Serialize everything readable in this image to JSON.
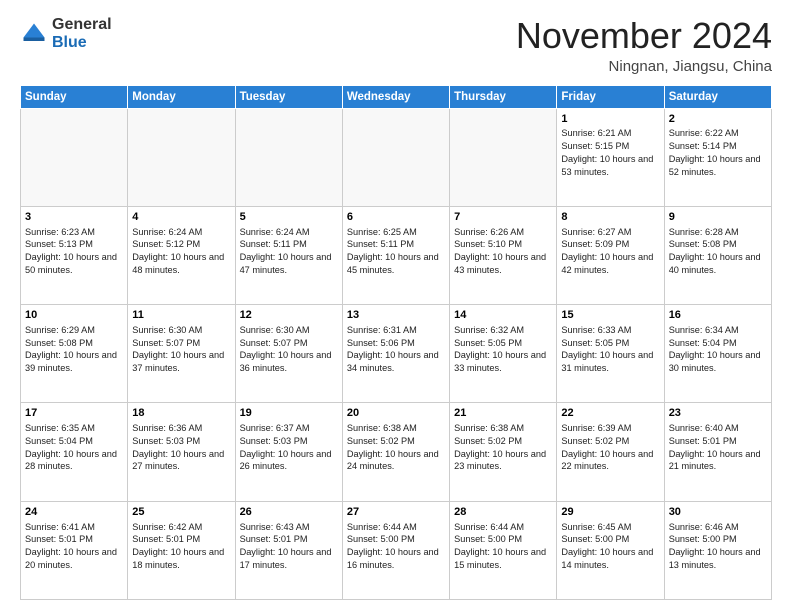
{
  "header": {
    "logo_general": "General",
    "logo_blue": "Blue",
    "month_title": "November 2024",
    "location": "Ningnan, Jiangsu, China"
  },
  "weekdays": [
    "Sunday",
    "Monday",
    "Tuesday",
    "Wednesday",
    "Thursday",
    "Friday",
    "Saturday"
  ],
  "weeks": [
    [
      {
        "day": "",
        "text": ""
      },
      {
        "day": "",
        "text": ""
      },
      {
        "day": "",
        "text": ""
      },
      {
        "day": "",
        "text": ""
      },
      {
        "day": "",
        "text": ""
      },
      {
        "day": "1",
        "text": "Sunrise: 6:21 AM\nSunset: 5:15 PM\nDaylight: 10 hours\nand 53 minutes."
      },
      {
        "day": "2",
        "text": "Sunrise: 6:22 AM\nSunset: 5:14 PM\nDaylight: 10 hours\nand 52 minutes."
      }
    ],
    [
      {
        "day": "3",
        "text": "Sunrise: 6:23 AM\nSunset: 5:13 PM\nDaylight: 10 hours\nand 50 minutes."
      },
      {
        "day": "4",
        "text": "Sunrise: 6:24 AM\nSunset: 5:12 PM\nDaylight: 10 hours\nand 48 minutes."
      },
      {
        "day": "5",
        "text": "Sunrise: 6:24 AM\nSunset: 5:11 PM\nDaylight: 10 hours\nand 47 minutes."
      },
      {
        "day": "6",
        "text": "Sunrise: 6:25 AM\nSunset: 5:11 PM\nDaylight: 10 hours\nand 45 minutes."
      },
      {
        "day": "7",
        "text": "Sunrise: 6:26 AM\nSunset: 5:10 PM\nDaylight: 10 hours\nand 43 minutes."
      },
      {
        "day": "8",
        "text": "Sunrise: 6:27 AM\nSunset: 5:09 PM\nDaylight: 10 hours\nand 42 minutes."
      },
      {
        "day": "9",
        "text": "Sunrise: 6:28 AM\nSunset: 5:08 PM\nDaylight: 10 hours\nand 40 minutes."
      }
    ],
    [
      {
        "day": "10",
        "text": "Sunrise: 6:29 AM\nSunset: 5:08 PM\nDaylight: 10 hours\nand 39 minutes."
      },
      {
        "day": "11",
        "text": "Sunrise: 6:30 AM\nSunset: 5:07 PM\nDaylight: 10 hours\nand 37 minutes."
      },
      {
        "day": "12",
        "text": "Sunrise: 6:30 AM\nSunset: 5:07 PM\nDaylight: 10 hours\nand 36 minutes."
      },
      {
        "day": "13",
        "text": "Sunrise: 6:31 AM\nSunset: 5:06 PM\nDaylight: 10 hours\nand 34 minutes."
      },
      {
        "day": "14",
        "text": "Sunrise: 6:32 AM\nSunset: 5:05 PM\nDaylight: 10 hours\nand 33 minutes."
      },
      {
        "day": "15",
        "text": "Sunrise: 6:33 AM\nSunset: 5:05 PM\nDaylight: 10 hours\nand 31 minutes."
      },
      {
        "day": "16",
        "text": "Sunrise: 6:34 AM\nSunset: 5:04 PM\nDaylight: 10 hours\nand 30 minutes."
      }
    ],
    [
      {
        "day": "17",
        "text": "Sunrise: 6:35 AM\nSunset: 5:04 PM\nDaylight: 10 hours\nand 28 minutes."
      },
      {
        "day": "18",
        "text": "Sunrise: 6:36 AM\nSunset: 5:03 PM\nDaylight: 10 hours\nand 27 minutes."
      },
      {
        "day": "19",
        "text": "Sunrise: 6:37 AM\nSunset: 5:03 PM\nDaylight: 10 hours\nand 26 minutes."
      },
      {
        "day": "20",
        "text": "Sunrise: 6:38 AM\nSunset: 5:02 PM\nDaylight: 10 hours\nand 24 minutes."
      },
      {
        "day": "21",
        "text": "Sunrise: 6:38 AM\nSunset: 5:02 PM\nDaylight: 10 hours\nand 23 minutes."
      },
      {
        "day": "22",
        "text": "Sunrise: 6:39 AM\nSunset: 5:02 PM\nDaylight: 10 hours\nand 22 minutes."
      },
      {
        "day": "23",
        "text": "Sunrise: 6:40 AM\nSunset: 5:01 PM\nDaylight: 10 hours\nand 21 minutes."
      }
    ],
    [
      {
        "day": "24",
        "text": "Sunrise: 6:41 AM\nSunset: 5:01 PM\nDaylight: 10 hours\nand 20 minutes."
      },
      {
        "day": "25",
        "text": "Sunrise: 6:42 AM\nSunset: 5:01 PM\nDaylight: 10 hours\nand 18 minutes."
      },
      {
        "day": "26",
        "text": "Sunrise: 6:43 AM\nSunset: 5:01 PM\nDaylight: 10 hours\nand 17 minutes."
      },
      {
        "day": "27",
        "text": "Sunrise: 6:44 AM\nSunset: 5:00 PM\nDaylight: 10 hours\nand 16 minutes."
      },
      {
        "day": "28",
        "text": "Sunrise: 6:44 AM\nSunset: 5:00 PM\nDaylight: 10 hours\nand 15 minutes."
      },
      {
        "day": "29",
        "text": "Sunrise: 6:45 AM\nSunset: 5:00 PM\nDaylight: 10 hours\nand 14 minutes."
      },
      {
        "day": "30",
        "text": "Sunrise: 6:46 AM\nSunset: 5:00 PM\nDaylight: 10 hours\nand 13 minutes."
      }
    ]
  ]
}
